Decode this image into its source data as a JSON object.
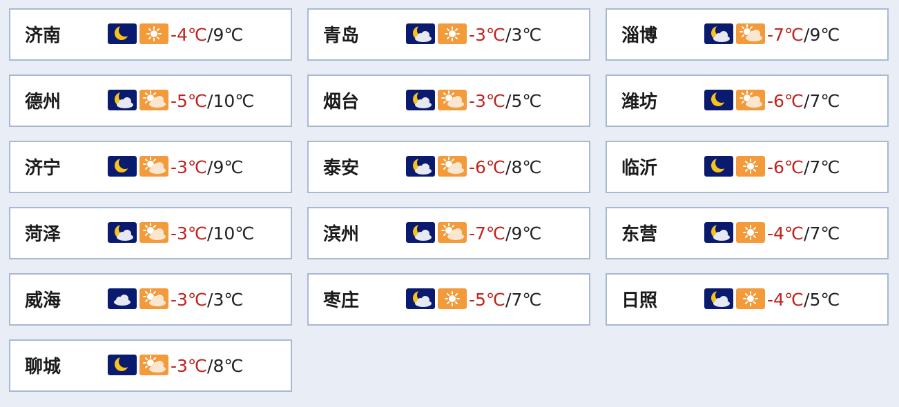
{
  "colors": {
    "low_temp": "#c0231d",
    "high_temp": "#222222",
    "night_bg": "#0a1a6e",
    "day_bg": "#f39a3a"
  },
  "separator": "/",
  "cities": [
    {
      "name": "济南",
      "night_icon": "moon-icon",
      "day_icon": "sun-icon",
      "low": "-4℃",
      "high": "9℃"
    },
    {
      "name": "青岛",
      "night_icon": "moon-cloud-icon",
      "day_icon": "sun-icon",
      "low": "-3℃",
      "high": "3℃"
    },
    {
      "name": "淄博",
      "night_icon": "moon-cloud-icon",
      "day_icon": "sun-cloud-icon",
      "low": "-7℃",
      "high": "9℃"
    },
    {
      "name": "德州",
      "night_icon": "moon-cloud-icon",
      "day_icon": "sun-cloud-icon",
      "low": "-5℃",
      "high": "10℃"
    },
    {
      "name": "烟台",
      "night_icon": "moon-cloud-icon",
      "day_icon": "sun-cloud-icon",
      "low": "-3℃",
      "high": "5℃"
    },
    {
      "name": "潍坊",
      "night_icon": "moon-icon",
      "day_icon": "sun-cloud-icon",
      "low": "-6℃",
      "high": "7℃"
    },
    {
      "name": "济宁",
      "night_icon": "moon-icon",
      "day_icon": "sun-cloud-icon",
      "low": "-3℃",
      "high": "9℃"
    },
    {
      "name": "泰安",
      "night_icon": "moon-cloud-icon",
      "day_icon": "sun-cloud-icon",
      "low": "-6℃",
      "high": "8℃"
    },
    {
      "name": "临沂",
      "night_icon": "moon-icon",
      "day_icon": "sun-icon",
      "low": "-6℃",
      "high": "7℃"
    },
    {
      "name": "菏泽",
      "night_icon": "moon-cloud-icon",
      "day_icon": "sun-cloud-icon",
      "low": "-3℃",
      "high": "10℃"
    },
    {
      "name": "滨州",
      "night_icon": "moon-cloud-icon",
      "day_icon": "sun-cloud-icon",
      "low": "-7℃",
      "high": "9℃"
    },
    {
      "name": "东营",
      "night_icon": "moon-cloud-icon",
      "day_icon": "sun-icon",
      "low": "-4℃",
      "high": "7℃"
    },
    {
      "name": "威海",
      "night_icon": "cloud-night-icon",
      "day_icon": "sun-cloud-icon",
      "low": "-3℃",
      "high": "3℃"
    },
    {
      "name": "枣庄",
      "night_icon": "moon-cloud-icon",
      "day_icon": "sun-icon",
      "low": "-5℃",
      "high": "7℃"
    },
    {
      "name": "日照",
      "night_icon": "moon-cloud-icon",
      "day_icon": "sun-icon",
      "low": "-4℃",
      "high": "5℃"
    },
    {
      "name": "聊城",
      "night_icon": "moon-icon",
      "day_icon": "sun-cloud-icon",
      "low": "-3℃",
      "high": "8℃"
    }
  ]
}
